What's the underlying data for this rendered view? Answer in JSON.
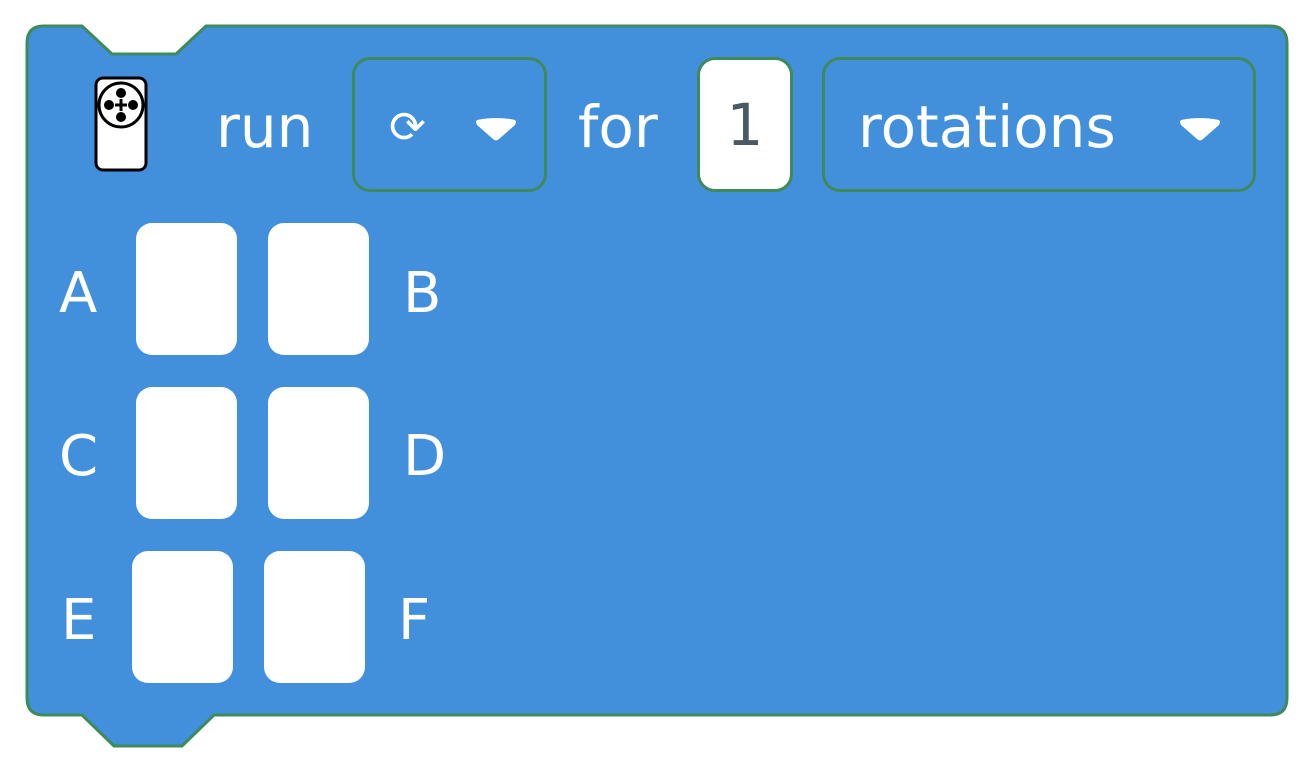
{
  "block": {
    "fill_color": "#4290dc",
    "border_color": "#3e8a5b",
    "run_label": "run",
    "for_label": "for",
    "direction_dropdown": {
      "selected_glyph": "⟳",
      "icon": "rotate-clockwise-icon"
    },
    "amount_value": "1",
    "units_dropdown": {
      "selected": "rotations"
    },
    "motor_icon": "motor-hub-icon",
    "ports": [
      {
        "left": "A",
        "right": "B"
      },
      {
        "left": "C",
        "right": "D"
      },
      {
        "left": "E",
        "right": "F"
      }
    ]
  }
}
